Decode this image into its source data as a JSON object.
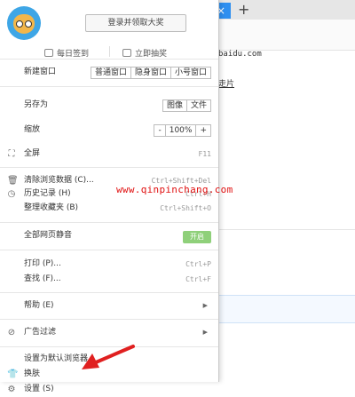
{
  "browser": {
    "tab_close": "×",
    "new_tab": "+",
    "address_text": "baidu.com",
    "link_text": "走片"
  },
  "header": {
    "login_button": "登录并领取大奖",
    "checkin": "每日签到",
    "lottery": "立即抽奖"
  },
  "menu": {
    "new_window": {
      "label": "新建窗口",
      "buttons": [
        "普通窗口",
        "隐身窗口",
        "小号窗口"
      ]
    },
    "save_as": {
      "label": "另存为",
      "buttons": [
        "图像",
        "文件"
      ]
    },
    "zoom": {
      "label": "缩放",
      "minus": "-",
      "value": "100%",
      "plus": "+"
    },
    "fullscreen": {
      "label": "全屏",
      "shortcut": "F11"
    },
    "clear_data": {
      "label": "清除浏览数据 (C)...",
      "shortcut": "Ctrl+Shift+Del"
    },
    "history": {
      "label": "历史记录 (H)",
      "shortcut": "Ctrl+H"
    },
    "favorites": {
      "label": "整理收藏夹 (B)",
      "shortcut": "Ctrl+Shift+O"
    },
    "mute": {
      "label": "全部网页静音",
      "toggle": "开启"
    },
    "print": {
      "label": "打印 (P)...",
      "shortcut": "Ctrl+P"
    },
    "find": {
      "label": "查找 (F)...",
      "shortcut": "Ctrl+F"
    },
    "help": {
      "label": "帮助 (E)",
      "arrow": "▶"
    },
    "adblock": {
      "label": "广告过滤",
      "arrow": "▶"
    },
    "set_default": {
      "label": "设置为默认浏览器"
    },
    "skin": {
      "label": "换肤"
    },
    "settings": {
      "label": "设置 (S)"
    }
  },
  "watermark": "www.qinpinchang.com"
}
